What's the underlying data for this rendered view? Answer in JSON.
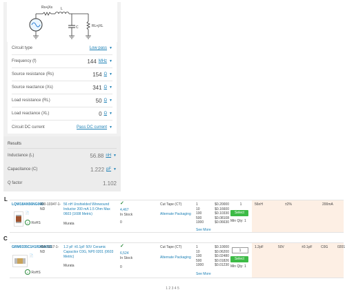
{
  "schematic": {
    "source_label": "Rs+jXs",
    "inductor_label": "L",
    "capacitor_label": "C",
    "load_label": "RL+jXL"
  },
  "form": {
    "rows": [
      {
        "label": "Circuit type",
        "value": "",
        "unit": "Low pass"
      },
      {
        "label": "Frequency (f)",
        "value": "144",
        "unit": "MHz"
      },
      {
        "label": "Source resistance (Rs)",
        "value": "154",
        "unit": "Ω"
      },
      {
        "label": "Source reactance (Xs)",
        "value": "341",
        "unit": "Ω"
      },
      {
        "label": "Load resistance (RL)",
        "value": "50",
        "unit": "Ω"
      },
      {
        "label": "Load reactance (XL)",
        "value": "0",
        "unit": "Ω"
      },
      {
        "label": "Circuit DC current",
        "value": "",
        "unit": "Pass DC current"
      }
    ]
  },
  "results": {
    "title": "Results",
    "rows": [
      {
        "label": "Inductance (L)",
        "value": "56.88",
        "unit": "nH"
      },
      {
        "label": "Capacitance (C)",
        "value": "1.222",
        "unit": "pF"
      },
      {
        "label": "Q factor",
        "value": "1.102",
        "unit": ""
      }
    ]
  },
  "parts": [
    {
      "section": "L",
      "part_number": "LQW18AN56NG00D",
      "mfr_number": "490-10347-1-ND",
      "description": "56 nH Unshielded Wirewound Inductor 200 mA 1.5 Ohm Max 0603 (1608 Metric)",
      "manufacturer": "Murata",
      "stock": "4,467",
      "stock_note": "In Stock",
      "qty_label": "0",
      "cut_tape": "Cut Tape (CT)",
      "alt_packaging": "Alternate Packaging",
      "rohs": "RoHS",
      "qty_box": "1",
      "add_button": "Select",
      "min_note": "Min Qty: 1",
      "price_rows": [
        [
          "1",
          "$0.20000"
        ],
        [
          "10",
          "$0.16600"
        ],
        [
          "100",
          "$0.10330"
        ],
        [
          "500",
          "$0.08108"
        ],
        [
          "1000",
          "$0.06630"
        ]
      ],
      "price_more": "See More",
      "attrs": [
        "56nH",
        "±2%",
        "200mA"
      ]
    },
    {
      "section": "C",
      "part_number": "GRM0335C1H1R2BA01D",
      "mfr_number": "490-5917-1-ND",
      "description": "1.2 pF ±0.1pF 50V Ceramic Capacitor C0G, NP0 0201 (0603 Metric)",
      "manufacturer": "Murata",
      "stock": "6,524",
      "stock_note": "In Stock",
      "qty_label": "0",
      "cut_tape": "Cut Tape (CT)",
      "alt_packaging": "Alternate Packaging",
      "rohs": "RoHS",
      "qty_box": "1",
      "add_button": "Select",
      "min_note": "Min Qty: 1",
      "price_rows": [
        [
          "1",
          "$0.10000"
        ],
        [
          "10",
          "$0.06200"
        ],
        [
          "100",
          "$0.02480"
        ],
        [
          "500",
          "$0.01826"
        ],
        [
          "1000",
          "$0.01230"
        ]
      ],
      "price_more": "See More",
      "attrs": [
        "1.2pF",
        "50V",
        "±0.1pF",
        "C0G",
        "0201"
      ]
    }
  ],
  "pager": "1 2 3 4 5"
}
